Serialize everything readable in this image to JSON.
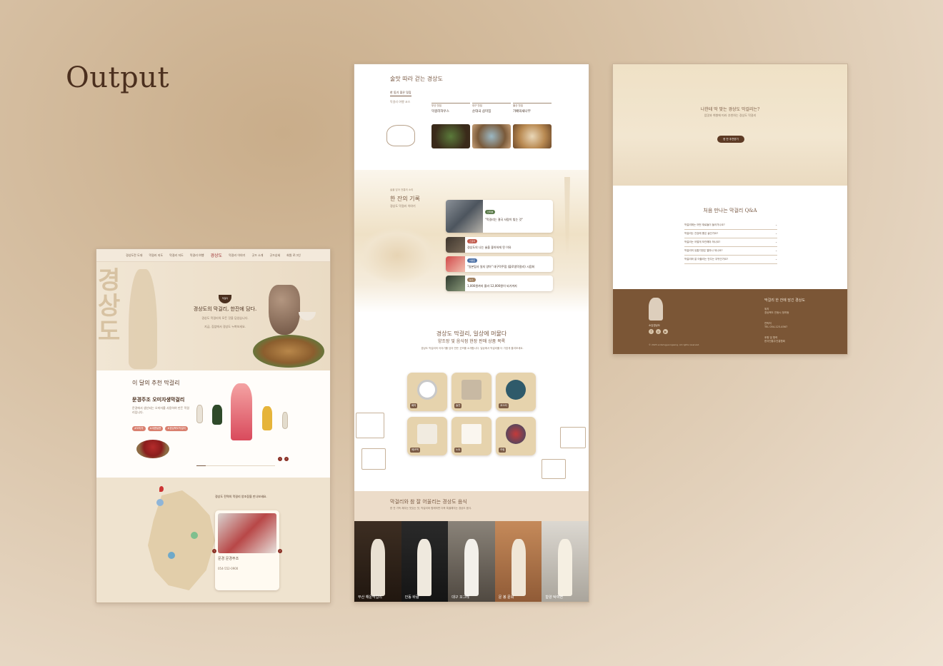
{
  "page": {
    "title": "Output"
  },
  "mock1": {
    "nav": [
      "경상도란 도대",
      "막걸리 지도",
      "막걸리 지도",
      "막걸리 여행"
    ],
    "nav_right": [
      "막걸리 이야기",
      "굿즈 소개",
      "굿즈상세",
      "회원 로그인"
    ],
    "logo": "경상도",
    "hero_big": "경상도",
    "hero_badge": "막걸리",
    "hero_title": "경상도의 막걸리, 한잔에 담다.",
    "hero_desc": "경상도 막걸리의 모든 것을 담았습니다.",
    "hero_link": "지금, 집앞에서 경상도 누벼보세요.",
    "sec2_title": "이 달의 추천 막걸리",
    "product_name": "문경주조 오미자생막걸리",
    "product_desc": "문경에서 생산되는 오미자를 사용하여 만든 막걸리입니다.",
    "tags": [
      "#오미자",
      "#새콤달콤",
      "#경상북도막걸리"
    ],
    "map_intro": "경상도 전역의 막걸리 양조장을 만나보세요.",
    "brewery_name": "문경 문경주조",
    "brewery_phone": "054-552-0900"
  },
  "mock2": {
    "sec1_title": "술맛 따라 걷는 경상도",
    "tab": "한 동기 좋은 맛집",
    "subtab": "막걸리 여행 코스",
    "places": [
      {
        "tag": "부산 맛집",
        "name": "막걸리하우스"
      },
      {
        "tag": "대구 맛집",
        "name": "순대국 삼미집"
      },
      {
        "tag": "울산 맛집",
        "name": "가배의새나무"
      }
    ],
    "sec2_kicker": "술을 담아 전통의 소리",
    "sec2_title": "한 잔의 기록",
    "sec2_sub": "경상도 막걸리 이야기",
    "news": [
      {
        "badge": "인터뷰",
        "text": "\"막걸리는 결국 사람이 빚는 것\""
      },
      {
        "badge": "스토리",
        "text": "경상도의 나는 술을 좋아하게 된 이유"
      },
      {
        "badge": "이벤트",
        "text": "\"일본탐사 일지 양아\" 대구막주점 (불로생막걸리) 시음회"
      },
      {
        "badge": "뉴스",
        "text": "1,000원까지 올라 12,000원이 되기까지"
      }
    ],
    "sec3_title": "경상도 막걸리, 일상에 머물다",
    "sec3_sub": "양조장 및 음식점 현장 판매 상품 목록",
    "sec3_desc": "경상도 막걸리의 이야기를 담아 만든 굿즈를 소개합니다. 일상에서 막걸리를 더 가깝게 즐겨보세요.",
    "goods": [
      "배지",
      "술잔",
      "코스터",
      "에코백",
      "노트",
      "키링"
    ],
    "sec4_title": "막걸리와 참 잘 어울리는 경상도 음식",
    "sec4_sub": "한 잔 가득 채우는 맛있는 맛, 막걸리와 함께하면 더욱 특별해지는 경상도 음식.",
    "photos": [
      "부산 해운막걸리",
      "안동 바람",
      "대구 꼬그레",
      "문 봉 문희",
      "함양 탁여현"
    ]
  },
  "mock3": {
    "hero_title": "나한테 딱 맞는 경상도 막걸리는?",
    "hero_sub": "입맛과 취향에 따라 추천하는 경상도 막걸리",
    "hero_btn": "한 잔 추천받기",
    "qa_title": "처음 만나는 막걸리 Q&A",
    "qa": [
      "막걸리에는 어떤 재료들이 들어가나요?",
      "막걸리는 건강에 좋은 술인가요?",
      "막걸리는 어떻게 보관해야 하나요?",
      "막걸리의 유통기한은 얼마나 되나요?",
      "막걸리와 잘 어울리는 안주는 무엇인가요?"
    ],
    "footer_brand": "소담경상도",
    "footer_title": "막걸리 한 잔에 담긴 경상도",
    "footer_blocks": [
      {
        "label": "위치",
        "value": "경상북도 안동시 정하동"
      },
      {
        "label": "연락처",
        "value": "TEL 054-123-4567"
      },
      {
        "label": "후원 및 협력",
        "value": "한국전통주진흥협회"
      }
    ],
    "copyright": "© 2025 sodamgyeongsang. All rights reserved."
  }
}
